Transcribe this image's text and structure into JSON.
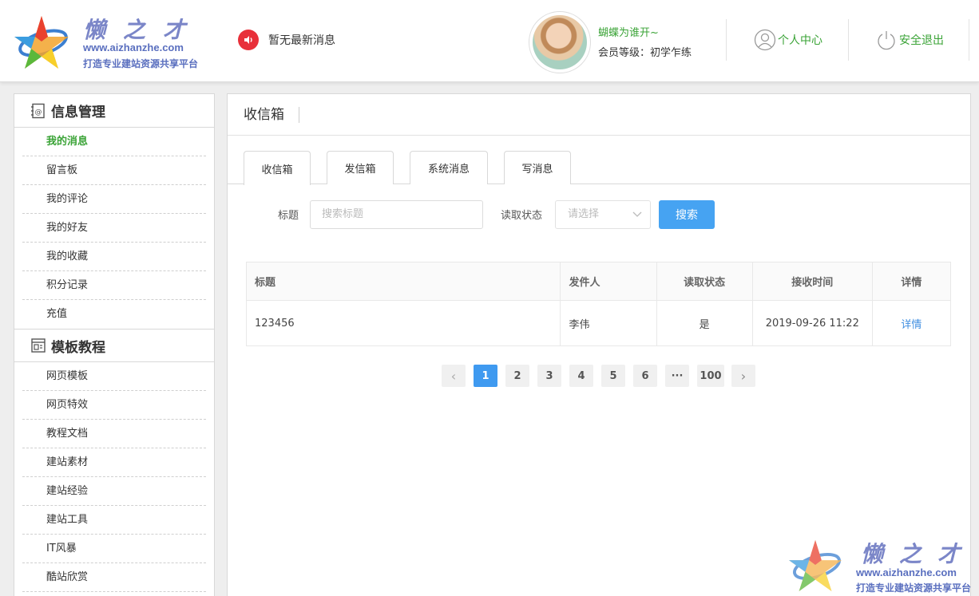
{
  "brand": {
    "title": "懒之才",
    "url": "www.aizhanzhe.com",
    "slogan": "打造专业建站资源共享平台"
  },
  "header": {
    "notice_icon": "speaker-icon",
    "notice_text": "暂无最新消息",
    "user_name": "蝴蝶为谁开~",
    "user_level": "会员等级：初学乍练",
    "profile_label": "个人中心",
    "profile_icon": "user-icon",
    "logout_label": "安全退出",
    "logout_icon": "power-icon",
    "accent_color": "#3aa336"
  },
  "sidebar": {
    "sections": [
      {
        "title": "信息管理",
        "icon": "address-book-icon",
        "items": [
          "我的消息",
          "留言板",
          "我的评论",
          "我的好友",
          "我的收藏",
          "积分记录",
          "充值"
        ]
      },
      {
        "title": "模板教程",
        "icon": "template-icon",
        "items": [
          "网页模板",
          "网页特效",
          "教程文档",
          "建站素材",
          "建站经验",
          "建站工具",
          "IT风暴",
          "酷站欣赏"
        ]
      }
    ],
    "active_item": "我的消息"
  },
  "main": {
    "title": "收信箱",
    "tabs": [
      "收信箱",
      "发信箱",
      "系统消息",
      "写消息"
    ],
    "active_tab": "收信箱",
    "search": {
      "title_label": "标题",
      "title_placeholder": "搜索标题",
      "status_label": "读取状态",
      "status_placeholder": "请选择",
      "button_label": "搜索",
      "button_color": "#46a3f2"
    },
    "table": {
      "columns": [
        "标题",
        "发件人",
        "读取状态",
        "接收时间",
        "详情"
      ],
      "rows": [
        {
          "title": "123456",
          "sender": "李伟",
          "status": "是",
          "time": "2019-09-26 11:22",
          "detail": "详情"
        }
      ]
    },
    "pagination": {
      "prev": "‹",
      "pages": [
        "1",
        "2",
        "3",
        "4",
        "5",
        "6",
        "···",
        "100"
      ],
      "next": "›",
      "current": "1"
    }
  }
}
